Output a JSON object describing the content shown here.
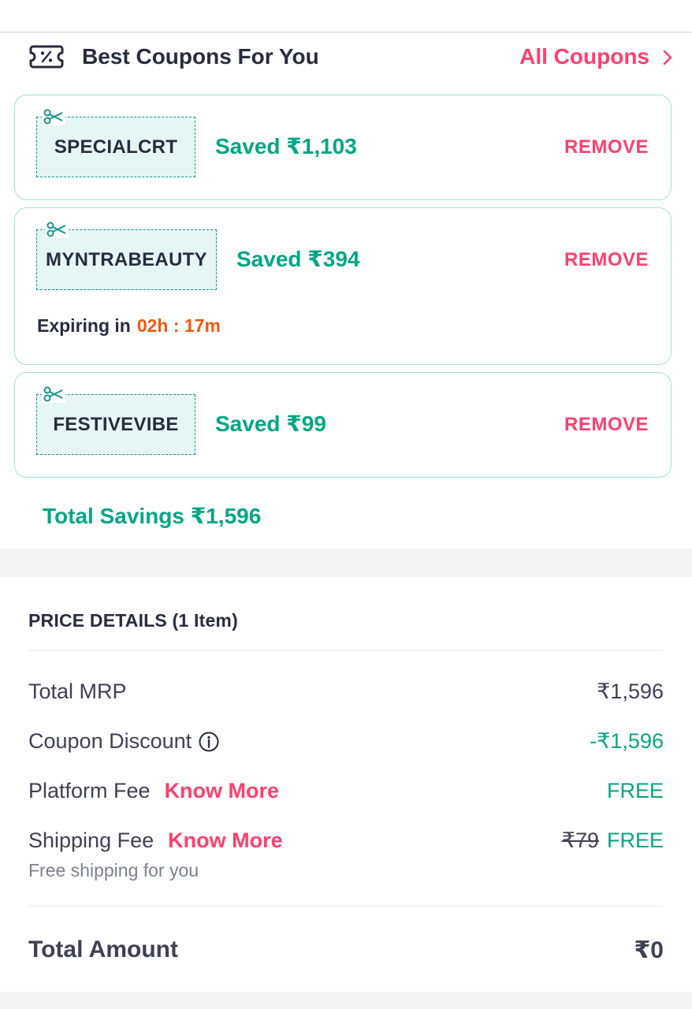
{
  "coupons": {
    "title": "Best Coupons For You",
    "all_coupons_label": "All Coupons",
    "items": [
      {
        "code": "SPECIALCRT",
        "saved": "Saved ₹1,103",
        "remove_label": "REMOVE"
      },
      {
        "code": "MYNTRABEAUTY",
        "saved": "Saved ₹394",
        "remove_label": "REMOVE",
        "expiring_label": "Expiring in",
        "expiring_time": "02h : 17m"
      },
      {
        "code": "FESTIVEVIBE",
        "saved": "Saved ₹99",
        "remove_label": "REMOVE"
      }
    ],
    "total_savings": "Total Savings ₹1,596"
  },
  "price_details": {
    "title": "PRICE DETAILS (1 Item)",
    "rows": {
      "mrp": {
        "label": "Total MRP",
        "value": "₹1,596"
      },
      "coupon_discount": {
        "label": "Coupon Discount",
        "value": "-₹1,596"
      },
      "platform_fee": {
        "label": "Platform Fee",
        "link": "Know More",
        "value": "FREE"
      },
      "shipping_fee": {
        "label": "Shipping Fee",
        "link": "Know More",
        "original": "₹79",
        "value": "FREE",
        "note": "Free shipping for you"
      }
    },
    "total": {
      "label": "Total Amount",
      "value": "₹0"
    }
  },
  "colors": {
    "accent_pink": "#ff3f6c",
    "success_green": "#03a685",
    "timer_orange": "#f5570a",
    "card_border": "#a6e0dd"
  },
  "icons": {
    "coupon_header": "discount-ticket-icon",
    "all_coupons": "chevron-right-icon",
    "code_box": "scissors-icon",
    "coupon_discount": "info-icon"
  }
}
